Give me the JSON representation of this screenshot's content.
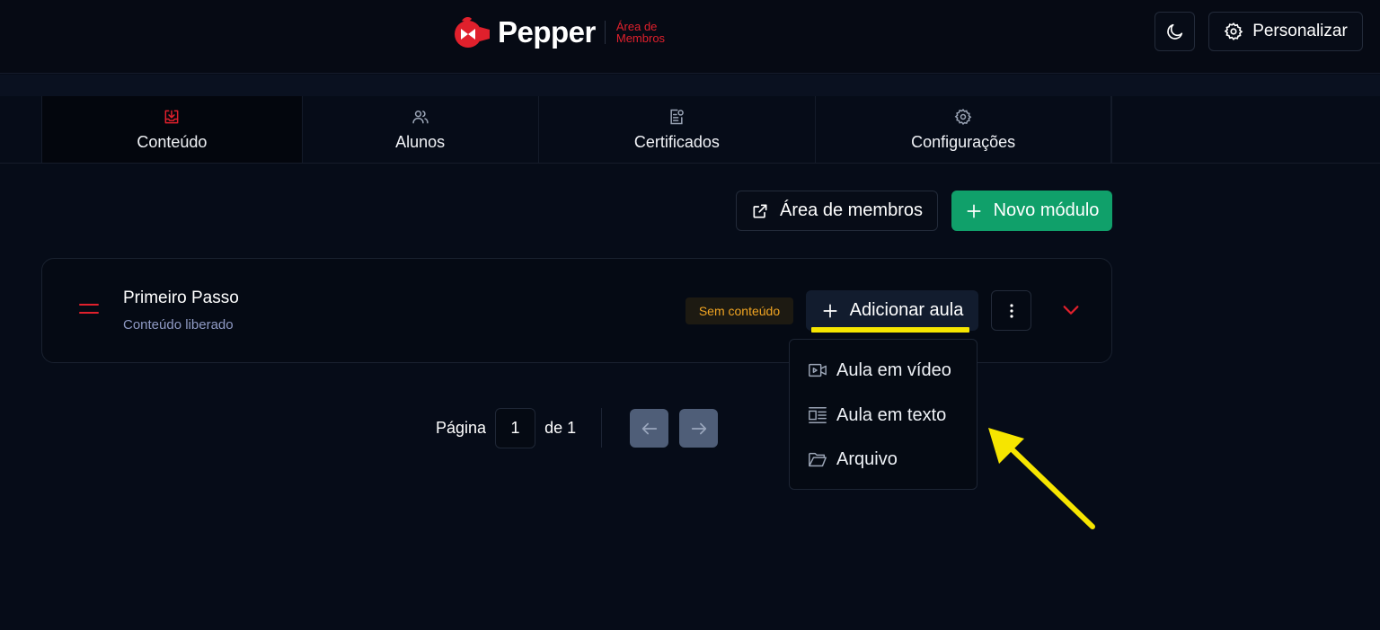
{
  "header": {
    "logo_text": "Pepper",
    "logo_subtitle": "Área de Membros",
    "theme_toggle_icon": "moon-icon",
    "customize_label": "Personalizar",
    "customize_icon": "gear-icon"
  },
  "tabs": [
    {
      "label": "Conteúdo",
      "icon": "inbox-download-icon",
      "active": true
    },
    {
      "label": "Alunos",
      "icon": "users-icon",
      "active": false
    },
    {
      "label": "Certificados",
      "icon": "certificate-icon",
      "active": false
    },
    {
      "label": "Configurações",
      "icon": "gear-icon",
      "active": false
    }
  ],
  "actions": {
    "members_area_label": "Área de membros",
    "new_module_label": "Novo módulo"
  },
  "module": {
    "title": "Primeiro Passo",
    "subtitle": "Conteúdo liberado",
    "badge": "Sem conteúdo",
    "add_lesson_label": "Adicionar aula"
  },
  "dropdown": {
    "items": [
      {
        "label": "Aula em vídeo",
        "icon": "video-icon"
      },
      {
        "label": "Aula em texto",
        "icon": "text-layout-icon"
      },
      {
        "label": "Arquivo",
        "icon": "folder-open-icon"
      }
    ]
  },
  "pagination": {
    "page_label": "Página",
    "current_page": "1",
    "of_label": "de 1"
  },
  "colors": {
    "background": "#060c18",
    "brand_red": "#e0202c",
    "primary_green": "#10a06a",
    "badge_text": "#f0a422",
    "annotation_yellow": "#f6e500"
  }
}
